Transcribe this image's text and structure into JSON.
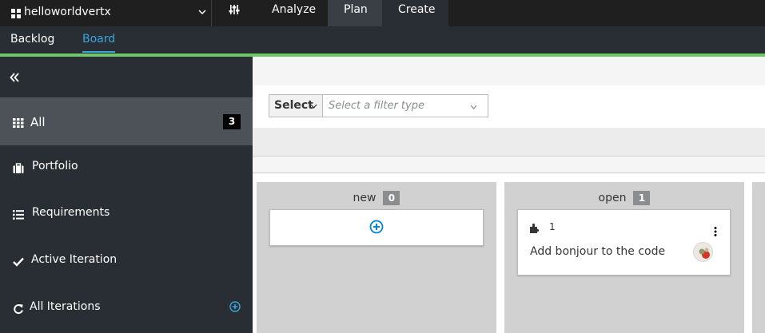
{
  "topbar": {
    "space_name": "helloworldvertx",
    "tabs": [
      {
        "label": "Analyze",
        "active": false
      },
      {
        "label": "Plan",
        "active": true
      },
      {
        "label": "Create",
        "active": false
      }
    ]
  },
  "subnav": {
    "tabs": [
      {
        "label": "Backlog",
        "active": false
      },
      {
        "label": "Board",
        "active": true
      }
    ]
  },
  "sidebar": {
    "items": [
      {
        "label": "All",
        "count": "3",
        "icon": "grid-icon",
        "active": true
      },
      {
        "label": "Portfolio",
        "icon": "briefcase-icon"
      },
      {
        "label": "Requirements",
        "icon": "list-icon"
      },
      {
        "label": "Active Iteration",
        "icon": "check-icon"
      },
      {
        "label": "All Iterations",
        "icon": "refresh-icon"
      }
    ]
  },
  "filter": {
    "select_label": "Select",
    "filter_type_placeholder": "Select a filter type"
  },
  "board": {
    "columns": [
      {
        "name": "new",
        "count": "0",
        "cards": []
      },
      {
        "name": "open",
        "count": "1",
        "cards": [
          {
            "number": "1",
            "title": "Add bonjour to the code",
            "icon": "puzzle-icon"
          }
        ]
      }
    ]
  },
  "colors": {
    "accent": "#39a5dc",
    "strip": "#6ec664",
    "navbar": "#1f1f1f",
    "sidebar": "#292e34"
  }
}
